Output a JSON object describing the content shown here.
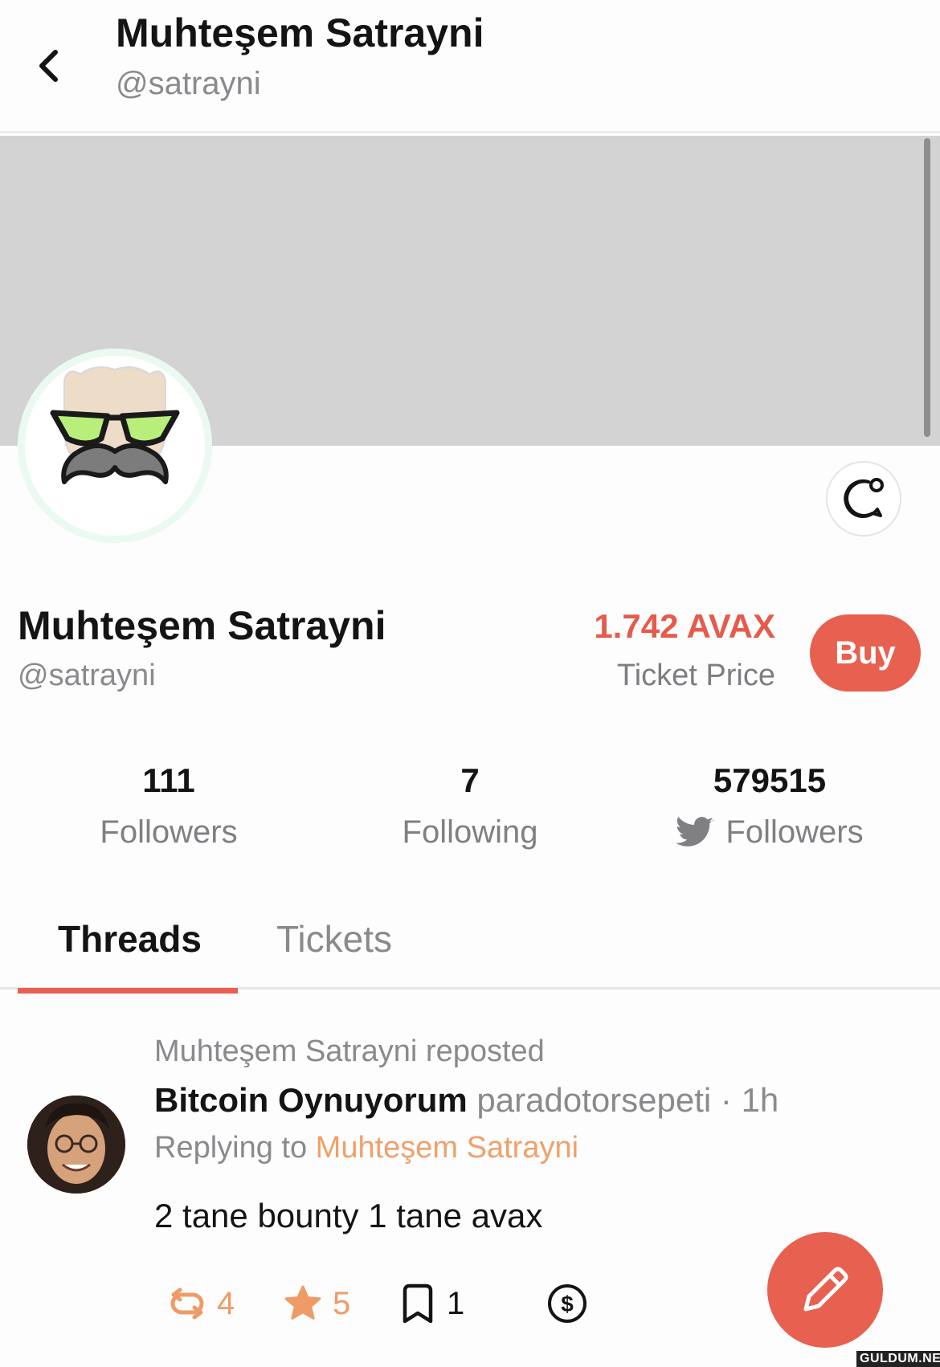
{
  "header": {
    "title": "Muhteşem Satrayni",
    "handle": "@satrayni"
  },
  "profile": {
    "name": "Muhteşem Satrayni",
    "handle": "@satrayni",
    "ticket_price_value": "1.742 AVAX",
    "ticket_price_label": "Ticket Price",
    "buy_label": "Buy"
  },
  "stats": [
    {
      "value": "111",
      "label": "Followers"
    },
    {
      "value": "7",
      "label": "Following"
    },
    {
      "value": "579515",
      "label": "Followers",
      "icon": "twitter-bird-icon"
    }
  ],
  "tabs": [
    {
      "label": "Threads",
      "active": true
    },
    {
      "label": "Tickets",
      "active": false
    }
  ],
  "post": {
    "repost_note": "Muhteşem Satrayni reposted",
    "author_name": "Bitcoin Oynuyorum",
    "author_handle": "paradotorsepeti",
    "separator": " · ",
    "time": "1h",
    "replying_prefix": "Replying to ",
    "replying_target": "Muhteşem Satrayni",
    "body": "2 tane bounty 1 tane avax",
    "actions": {
      "repost_count": "4",
      "like_count": "5",
      "bookmark_count": "1"
    }
  },
  "colors": {
    "accent": "#e8604f",
    "price": "#e55b4c",
    "orange_icon": "#ef9b68",
    "muted_text": "#8a8a8e",
    "banner": "#d3d3d3"
  },
  "watermark": "GULDUM.NET"
}
